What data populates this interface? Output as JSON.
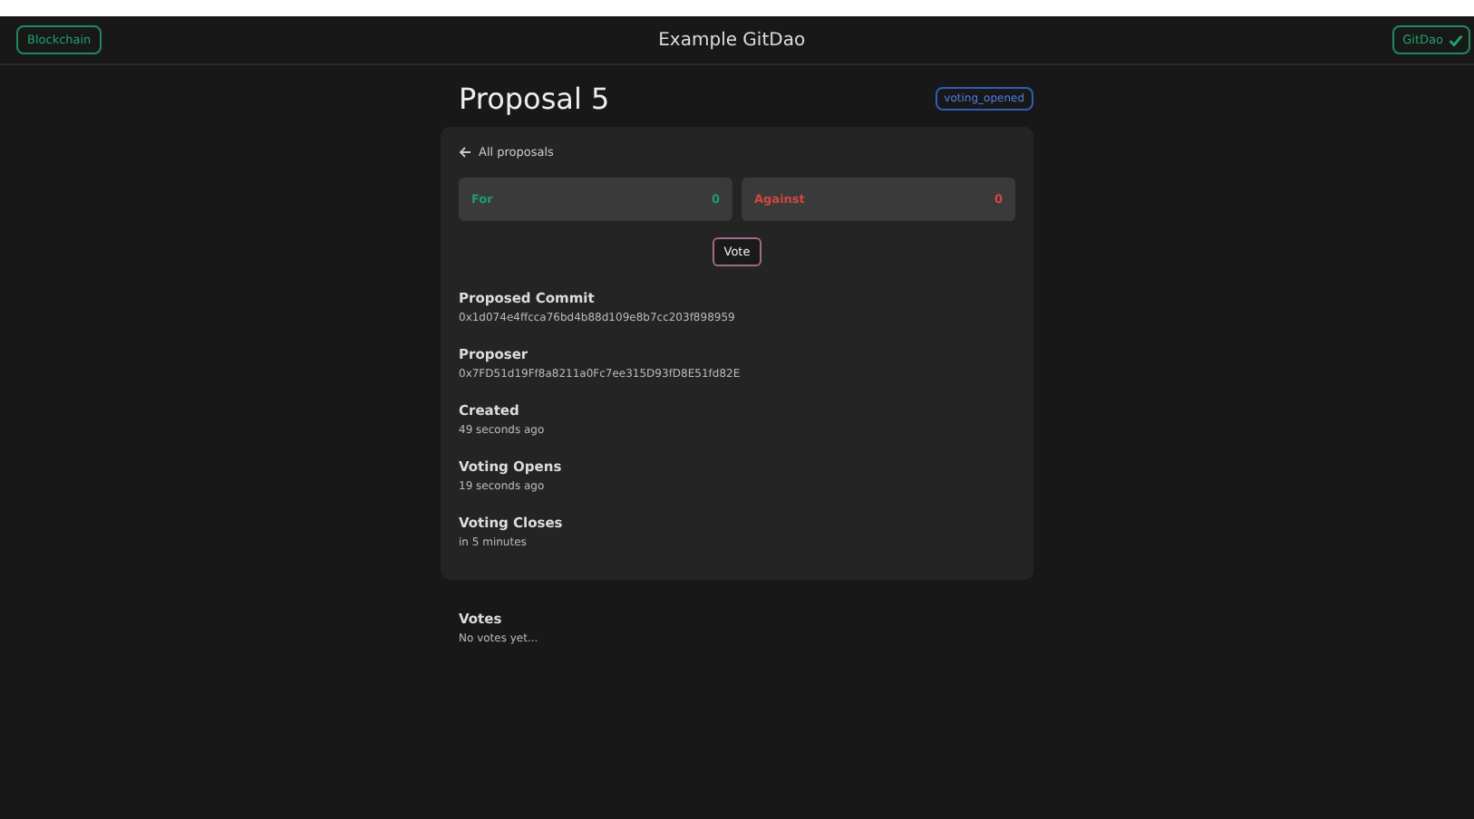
{
  "header": {
    "left_button": "Blockchain",
    "title": "Example GitDao",
    "right_button": "GitDao"
  },
  "proposal": {
    "title": "Proposal 5",
    "status": "voting_opened"
  },
  "back_link": "All proposals",
  "tallies": [
    {
      "kind": "for",
      "label": "For",
      "count": "0"
    },
    {
      "kind": "against",
      "label": "Against",
      "count": "0"
    }
  ],
  "vote_button": "Vote",
  "details": [
    {
      "label": "Proposed Commit",
      "value": "0x1d074e4ffcca76bd4b88d109e8b7cc203f898959"
    },
    {
      "label": "Proposer",
      "value": "0x7FD51d19Ff8a8211a0Fc7ee315D93fD8E51fd82E"
    },
    {
      "label": "Created",
      "value": "49 seconds ago"
    },
    {
      "label": "Voting Opens",
      "value": "19 seconds ago"
    },
    {
      "label": "Voting Closes",
      "value": "in 5 minutes"
    }
  ],
  "votes": {
    "label": "Votes",
    "value": "No votes yet..."
  }
}
